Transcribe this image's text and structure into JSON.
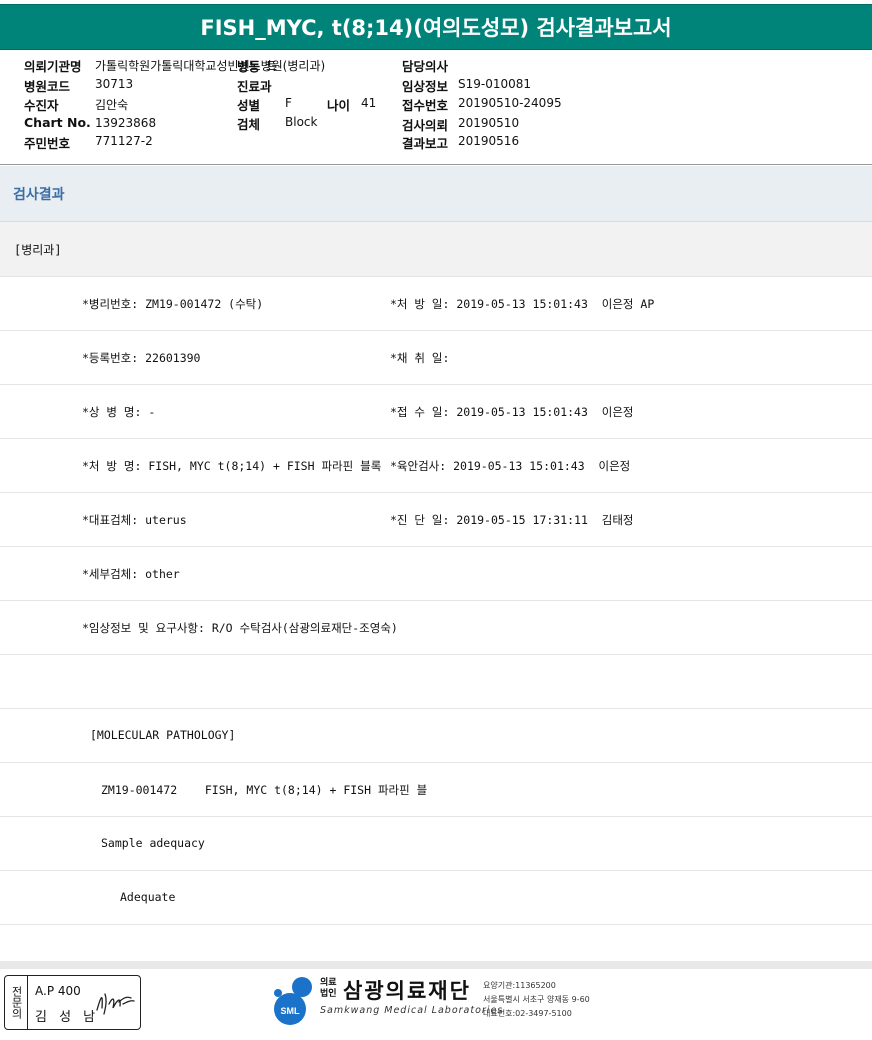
{
  "title": "FISH_MYC, t(8;14)(여의도성모) 검사결과보고서",
  "info": {
    "institution_label": "의뢰기관명",
    "institution_value": "가톨릭학원가톨릭대학교성빈센트병원(병리과)",
    "hospital_code_label": "병원코드",
    "hospital_code_value": "30713",
    "patient_label": "수진자",
    "patient_value": "김안숙",
    "chart_label": "Chart No.",
    "chart_value": "13923868",
    "rrn_label": "주민번호",
    "rrn_value": "771127-2",
    "ward_label": "병동",
    "ward_value": "트",
    "dept_label": "진료과",
    "sex_label": "성별",
    "sex_value": "F",
    "age_label": "나이",
    "age_value": "41",
    "specimen_label": "검체",
    "specimen_value": "Block",
    "doctor_label": "담당의사",
    "clinical_label": "임상정보",
    "clinical_value": "S19-010081",
    "receipt_label": "접수번호",
    "receipt_value": "20190510-24095",
    "request_label": "검사의뢰",
    "request_value": "20190510",
    "report_label": "결과보고",
    "report_value": "20190516"
  },
  "section_title": "검사결과",
  "department": "[병리과]",
  "rows": [
    {
      "left": "*병리번호: ZM19-001472 (수탁)",
      "right": "*처 방 일: 2019-05-13 15:01:43  이은정 AP"
    },
    {
      "left": "*등록번호: 22601390",
      "right": "*채 취 일:"
    },
    {
      "left": "*상 병 명: -",
      "right": "*접 수 일: 2019-05-13 15:01:43  이은정"
    },
    {
      "left": "*처 방 명: FISH, MYC t(8;14) + FISH 파라핀 블록",
      "right": "*육안검사: 2019-05-13 15:01:43  이은정"
    },
    {
      "left": "*대표검체: uterus",
      "right": "*진 단 일: 2019-05-15 17:31:11  김태정"
    },
    {
      "left": "*세부검체: other",
      "right": ""
    },
    {
      "left": "*임상정보 및 요구사항: R/O 수탁검사(삼광의료재단-조영숙)",
      "right": ""
    },
    {
      "left": "",
      "right": ""
    }
  ],
  "report_lines": [
    "[MOLECULAR PATHOLOGY]",
    "ZM19-001472    FISH, MYC t(8;14) + FISH 파라핀 블",
    "Sample adequacy",
    "Adequate",
    ""
  ],
  "footer": {
    "sign_vertical": "전문의",
    "sign_ap": "A.P 400",
    "sign_name": "김 성 남",
    "org_small": "의료법인",
    "org_name": "삼광의료재단",
    "org_en": "Samkwang Medical Laboratories",
    "org_code": "요양기관:11365200",
    "org_address": "서울특별시 서초구 양재동 9-60",
    "org_phone": "대표번호:02-3497-5100",
    "logo_badge": "SML",
    "brand_color": "#1a73c9"
  }
}
